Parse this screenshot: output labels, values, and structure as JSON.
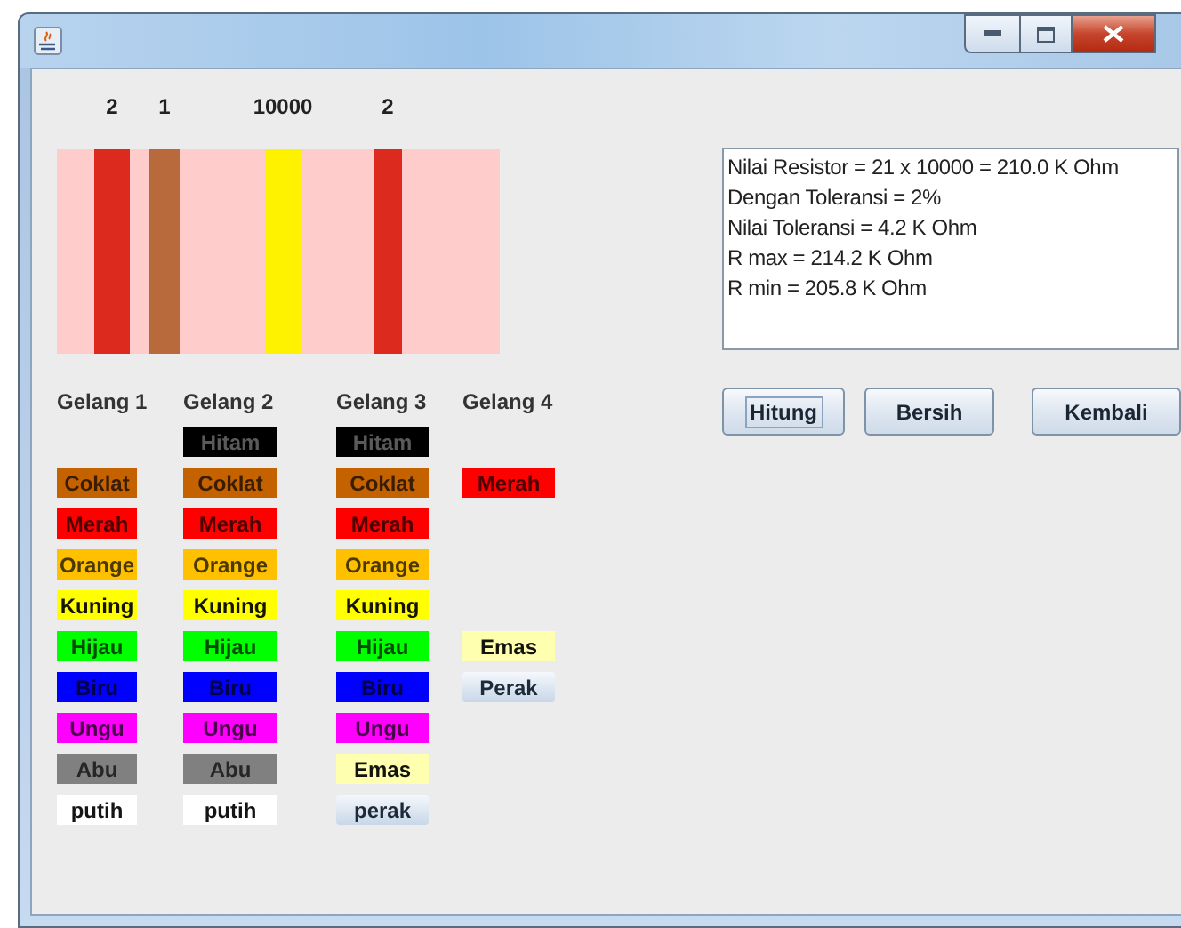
{
  "resistor": {
    "bands": [
      {
        "digit": "2",
        "color": "#dd2a1e"
      },
      {
        "digit": "1",
        "color": "#b86a3c"
      },
      {
        "digit": "10000",
        "color": "#fff200"
      },
      {
        "digit": "2",
        "color": "#dd2a1e"
      }
    ]
  },
  "columns": [
    {
      "header": "Gelang 1",
      "items": [
        {
          "kind": "spacer"
        },
        {
          "kind": "swatch",
          "label": "Coklat",
          "color": "#c46200"
        },
        {
          "kind": "swatch",
          "label": "Merah",
          "color": "#ff0000"
        },
        {
          "kind": "swatch",
          "label": "Orange",
          "color": "#ffc000"
        },
        {
          "kind": "swatch",
          "label": "Kuning",
          "color": "#ffff00"
        },
        {
          "kind": "swatch",
          "label": "Hijau",
          "color": "#00ff00"
        },
        {
          "kind": "swatch",
          "label": "Biru",
          "color": "#0000ff"
        },
        {
          "kind": "swatch",
          "label": "Ungu",
          "color": "#ff00ff"
        },
        {
          "kind": "swatch",
          "label": "Abu",
          "color": "#808080"
        },
        {
          "kind": "swatch",
          "label": "putih",
          "color": "#ffffff"
        }
      ]
    },
    {
      "header": "Gelang 2",
      "items": [
        {
          "kind": "swatch",
          "label": "Hitam",
          "color": "#000000"
        },
        {
          "kind": "swatch",
          "label": "Coklat",
          "color": "#c46200"
        },
        {
          "kind": "swatch",
          "label": "Merah",
          "color": "#ff0000"
        },
        {
          "kind": "swatch",
          "label": "Orange",
          "color": "#ffc000"
        },
        {
          "kind": "swatch",
          "label": "Kuning",
          "color": "#ffff00"
        },
        {
          "kind": "swatch",
          "label": "Hijau",
          "color": "#00ff00"
        },
        {
          "kind": "swatch",
          "label": "Biru",
          "color": "#0000ff"
        },
        {
          "kind": "swatch",
          "label": "Ungu",
          "color": "#ff00ff"
        },
        {
          "kind": "swatch",
          "label": "Abu",
          "color": "#808080"
        },
        {
          "kind": "swatch",
          "label": "putih",
          "color": "#ffffff"
        }
      ]
    },
    {
      "header": "Gelang 3",
      "items": [
        {
          "kind": "swatch",
          "label": "Hitam",
          "color": "#000000"
        },
        {
          "kind": "swatch",
          "label": "Coklat",
          "color": "#c46200"
        },
        {
          "kind": "swatch",
          "label": "Merah",
          "color": "#ff0000"
        },
        {
          "kind": "swatch",
          "label": "Orange",
          "color": "#ffc000"
        },
        {
          "kind": "swatch",
          "label": "Kuning",
          "color": "#ffff00"
        },
        {
          "kind": "swatch",
          "label": "Hijau",
          "color": "#00ff00"
        },
        {
          "kind": "swatch",
          "label": "Biru",
          "color": "#0000ff"
        },
        {
          "kind": "swatch",
          "label": "Ungu",
          "color": "#ff00ff"
        },
        {
          "kind": "swatch",
          "label": "Emas",
          "color": "#ffffb0"
        },
        {
          "kind": "button",
          "label": "perak"
        }
      ]
    },
    {
      "header": "Gelang 4",
      "items": [
        {
          "kind": "spacer"
        },
        {
          "kind": "swatch",
          "label": "Merah",
          "color": "#ff0000"
        },
        {
          "kind": "spacer"
        },
        {
          "kind": "spacer"
        },
        {
          "kind": "spacer"
        },
        {
          "kind": "swatch",
          "label": "Emas",
          "color": "#ffffb0"
        },
        {
          "kind": "button",
          "label": "Perak"
        }
      ]
    }
  ],
  "result": {
    "lines": [
      "Nilai Resistor = 21 x 10000 = 210.0 K Ohm",
      "Dengan Toleransi = 2%",
      "Nilai Toleransi = 4.2 K Ohm",
      "R max = 214.2 K Ohm",
      "R min = 205.8 K Ohm"
    ]
  },
  "buttons": [
    {
      "label": "Hitung",
      "focused": true
    },
    {
      "label": "Bersih",
      "focused": false
    },
    {
      "label": "Kembali",
      "focused": false
    }
  ]
}
